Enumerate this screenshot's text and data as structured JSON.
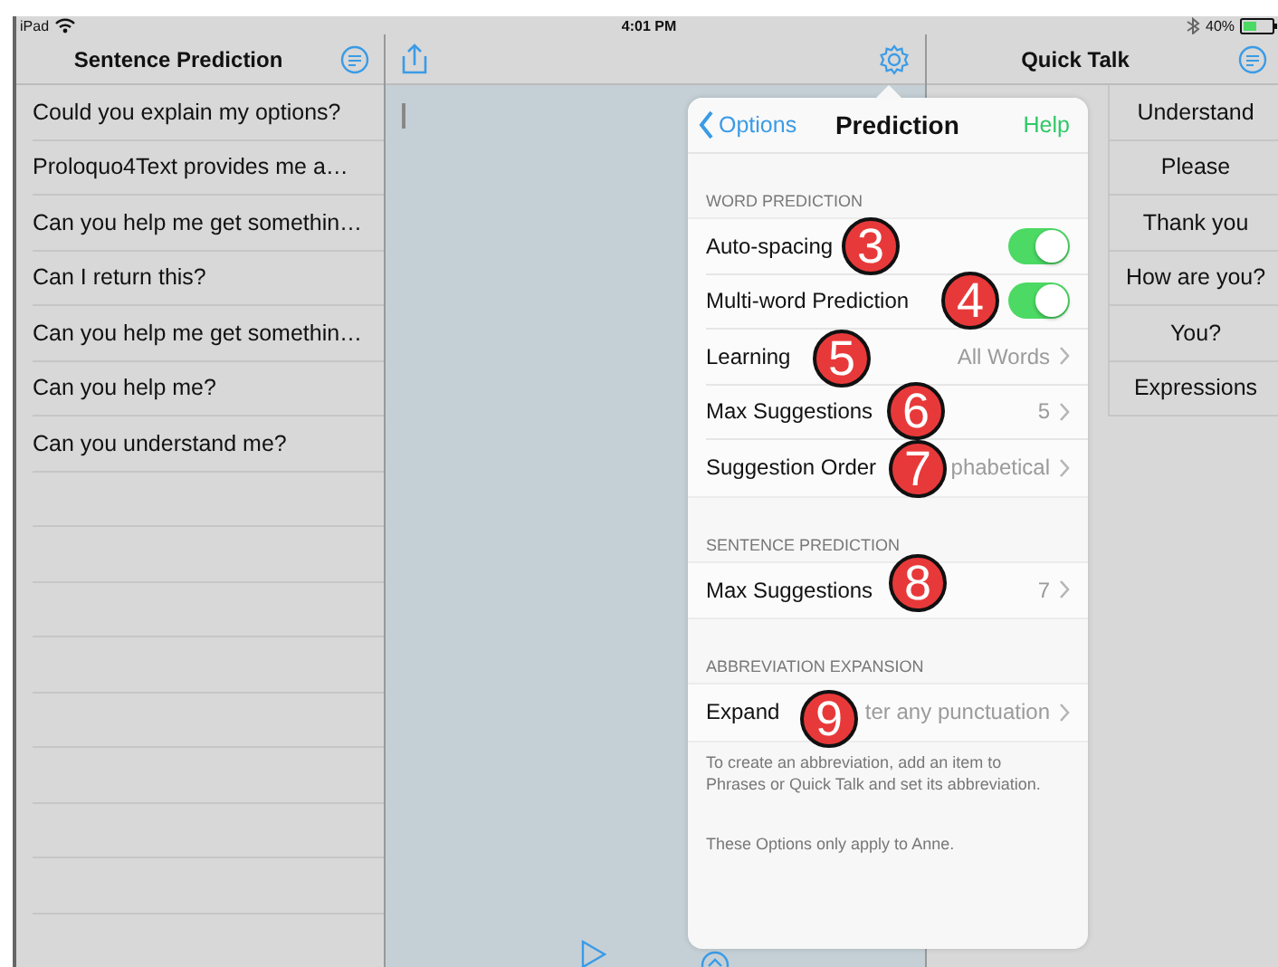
{
  "status_bar": {
    "device": "iPad",
    "time": "4:01 PM",
    "battery": "40%"
  },
  "sentence_panel": {
    "title": "Sentence Prediction",
    "items": [
      "Could you explain my options?",
      "Proloquo4Text provides me a…",
      "Can you help me get somethin…",
      "Can I return this?",
      "Can you help me get somethin…",
      "Can you help me?",
      "Can you understand me?"
    ]
  },
  "quick_talk": {
    "title": "Quick Talk",
    "items": [
      "Understand",
      "Please",
      "Thank you",
      "How are you?",
      "You?",
      "Expressions"
    ]
  },
  "popover": {
    "back": "Options",
    "title": "Prediction",
    "help": "Help",
    "sections": [
      {
        "header": "WORD PREDICTION",
        "rows": [
          {
            "kind": "toggle",
            "label": "Auto-spacing",
            "on": true
          },
          {
            "kind": "toggle",
            "label": "Multi-word Prediction",
            "on": true
          },
          {
            "kind": "link",
            "label": "Learning",
            "value": "All Words"
          },
          {
            "kind": "link",
            "label": "Max Suggestions",
            "value": "5"
          },
          {
            "kind": "link",
            "label": "Suggestion Order",
            "value": "phabetical"
          }
        ]
      },
      {
        "header": "SENTENCE PREDICTION",
        "rows": [
          {
            "kind": "link",
            "label": "Max Suggestions",
            "value": "7"
          }
        ]
      },
      {
        "header": "ABBREVIATION EXPANSION",
        "rows": [
          {
            "kind": "link",
            "label": "Expand",
            "value": "ter any punctuation"
          }
        ],
        "footer": "To create an abbreviation, add an item to Phrases or Quick Talk and set its abbreviation."
      }
    ],
    "note": "These Options only apply to Anne."
  },
  "callouts": [
    "3",
    "4",
    "5",
    "6",
    "7",
    "8",
    "9"
  ]
}
